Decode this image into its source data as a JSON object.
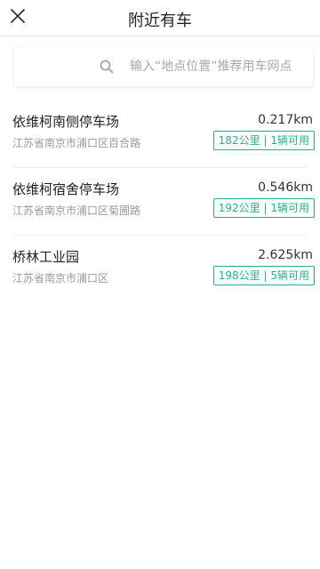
{
  "header": {
    "title": "附近有车",
    "close_icon": "close-icon"
  },
  "search": {
    "placeholder": "输入“地点位置”推荐用车网点",
    "icon": "search-icon"
  },
  "colors": {
    "accent": "#20b58e",
    "secondary_text": "#9a9a9a"
  },
  "stations": [
    {
      "name": "依维柯南侧停车场",
      "distance": "0.217km",
      "address": "江苏省南京市浦口区百合路",
      "badge": "182公里 | 1辆可用"
    },
    {
      "name": "依维柯宿舍停车场",
      "distance": "0.546km",
      "address": "江苏省南京市浦口区菊圃路",
      "badge": "192公里 | 1辆可用"
    },
    {
      "name": "桥林工业园",
      "distance": "2.625km",
      "address": "江苏省南京市浦口区",
      "badge": "198公里 | 5辆可用"
    }
  ]
}
